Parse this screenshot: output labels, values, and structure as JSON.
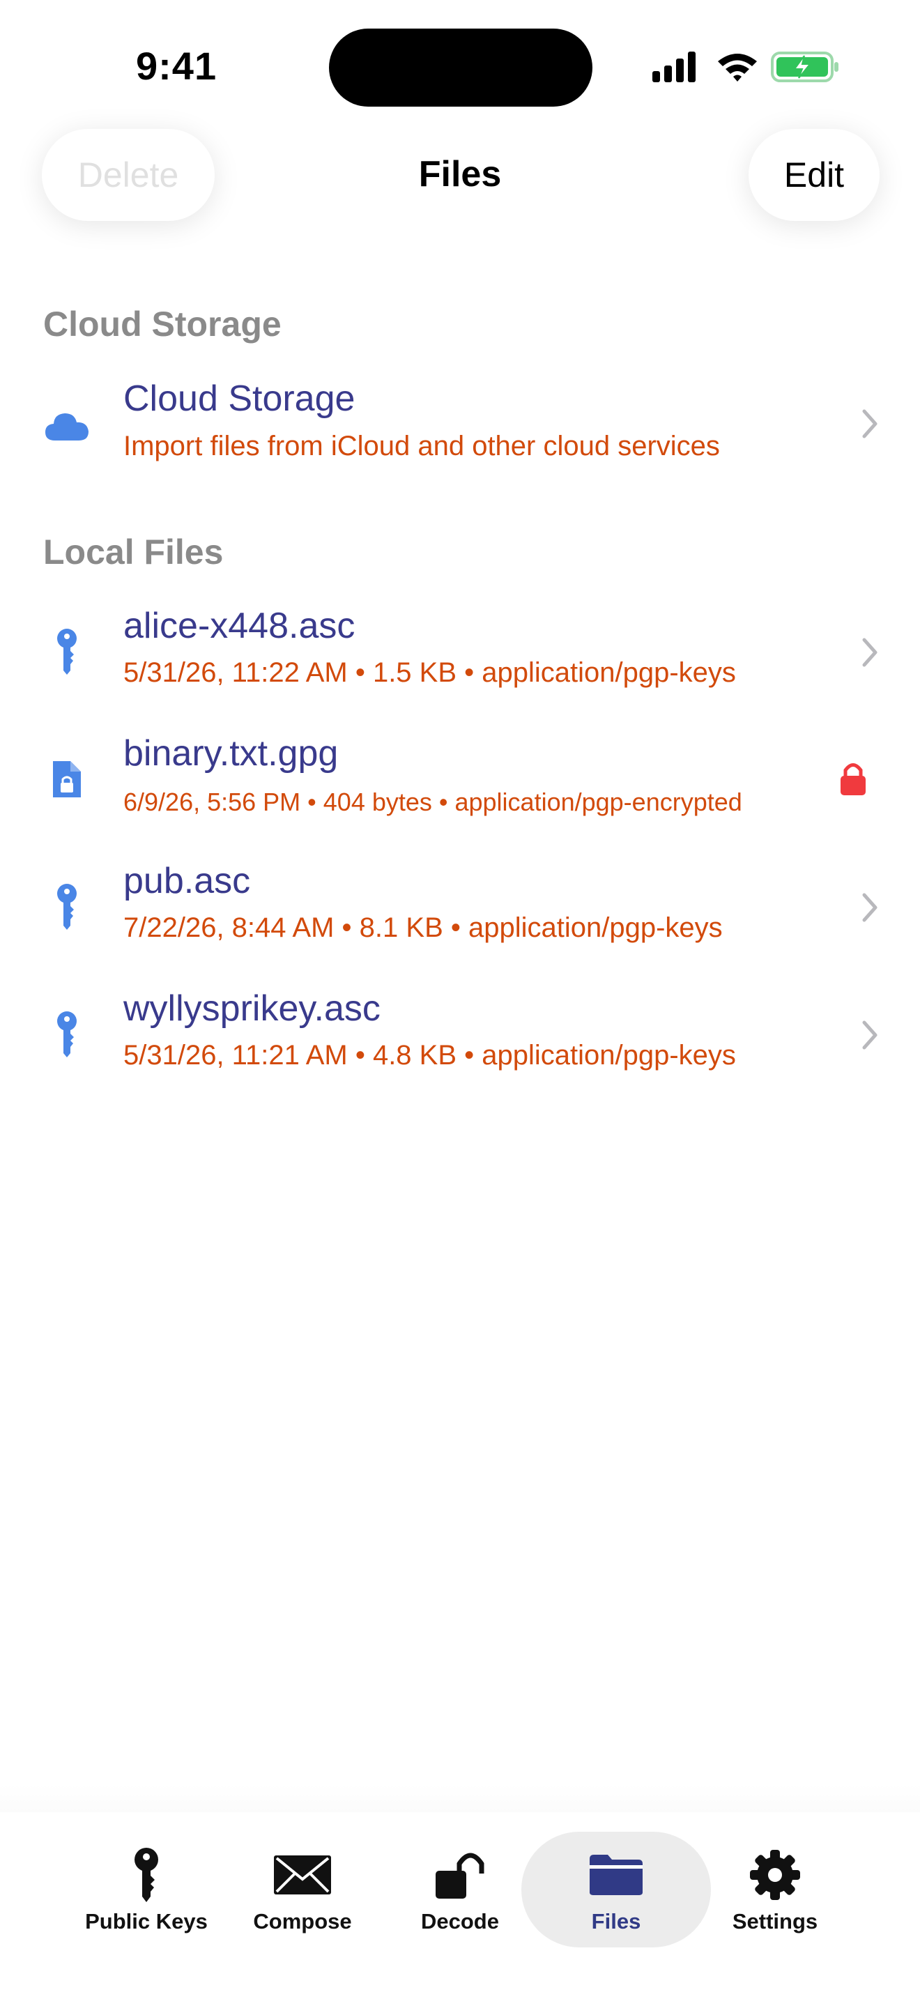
{
  "status_bar": {
    "time": "9:41",
    "icons": [
      "cellular-signal-icon",
      "wifi-icon",
      "battery-charging-icon"
    ],
    "battery_color": "#30c35a"
  },
  "nav": {
    "delete_label": "Delete",
    "title": "Files",
    "edit_label": "Edit"
  },
  "cloud_section": {
    "header": "Cloud Storage",
    "item": {
      "icon": "cloud-icon",
      "title": "Cloud Storage",
      "subtitle": "Import files from iCloud and other cloud services"
    }
  },
  "local_section": {
    "header": "Local Files",
    "files": [
      {
        "icon": "key-icon",
        "name": "alice-x448.asc",
        "meta": "5/31/26, 11:22 AM • 1.5 KB • application/pgp-keys",
        "accessory": "chevron"
      },
      {
        "icon": "encrypted-document-icon",
        "name": "binary.txt.gpg",
        "meta": "6/9/26, 5:56 PM • 404 bytes • application/pgp-encrypted",
        "accessory": "lock"
      },
      {
        "icon": "key-icon",
        "name": "pub.asc",
        "meta": "7/22/26, 8:44 AM • 8.1 KB • application/pgp-keys",
        "accessory": "chevron"
      },
      {
        "icon": "key-icon",
        "name": "wyllysprikey.asc",
        "meta": "5/31/26, 11:21 AM • 4.8 KB • application/pgp-keys",
        "accessory": "chevron"
      }
    ]
  },
  "tab_bar": {
    "tabs": [
      {
        "label": "Public Keys",
        "icon": "key-icon"
      },
      {
        "label": "Compose",
        "icon": "envelope-icon"
      },
      {
        "label": "Decode",
        "icon": "unlocked-padlock-icon"
      },
      {
        "label": "Files",
        "icon": "folder-icon",
        "active": true
      },
      {
        "label": "Settings",
        "icon": "gear-icon"
      }
    ]
  },
  "colors": {
    "title_text": "#393a8c",
    "subtitle_text": "#d24a0b",
    "icon_blue": "#4a86e6",
    "lock_red": "#f03a3e",
    "active_tab": "#303a86"
  }
}
